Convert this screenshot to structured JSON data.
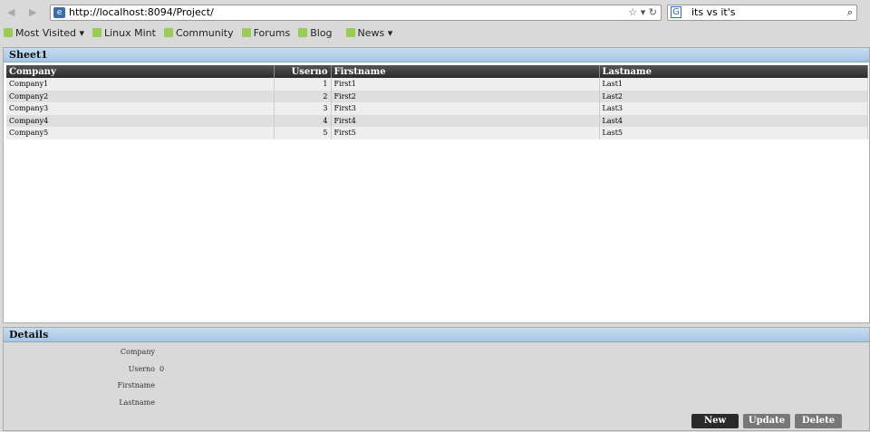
{
  "browser": {
    "url": "http://localhost:8094/Project/",
    "search": "its vs it's",
    "bookmarks": [
      "Most Visited ▾",
      "Linux Mint",
      "Community",
      "Forums",
      "Blog",
      "News ▾"
    ]
  },
  "sheet": {
    "title": "Sheet1",
    "columns": [
      "Company",
      "Userno",
      "Firstname",
      "Lastname"
    ],
    "rows": [
      [
        "Company1",
        "1",
        "First1",
        "Last1"
      ],
      [
        "Company2",
        "2",
        "First2",
        "Last2"
      ],
      [
        "Company3",
        "3",
        "First3",
        "Last3"
      ],
      [
        "Company4",
        "4",
        "First4",
        "Last4"
      ],
      [
        "Company5",
        "5",
        "First5",
        "Last5"
      ]
    ]
  },
  "details": {
    "title": "Details",
    "labels": [
      "Company",
      "Userno",
      "Firstname",
      "Lastname"
    ],
    "values": [
      "",
      "0",
      "",
      ""
    ],
    "buttons": [
      "New",
      "Update",
      "Delete"
    ]
  }
}
